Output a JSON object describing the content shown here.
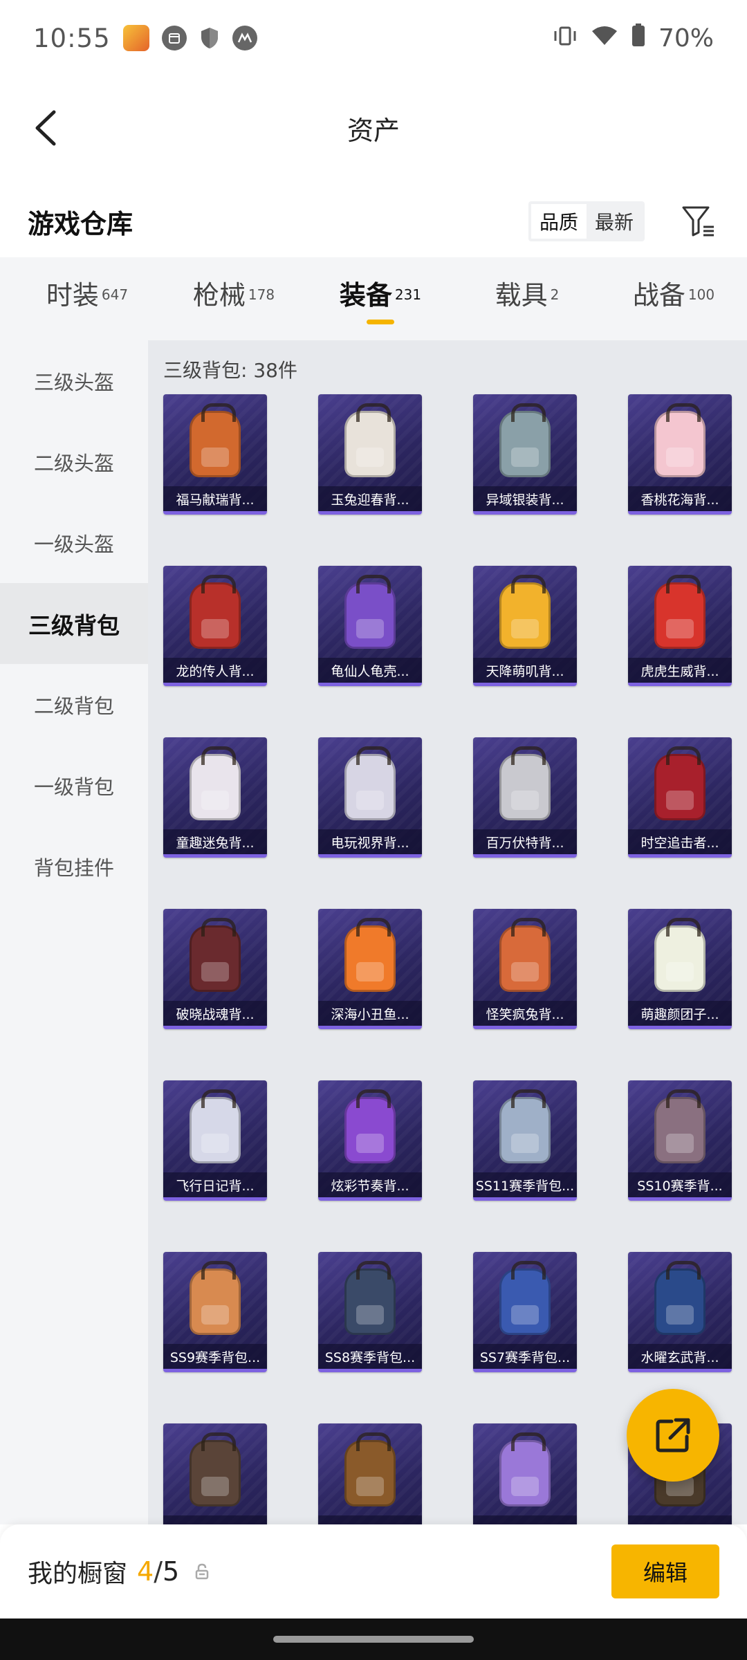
{
  "status_bar": {
    "time": "10:55",
    "battery": "70%",
    "icons": [
      "game-app-icon",
      "calendar-icon",
      "shield-icon",
      "motorola-icon",
      "vibrate-icon",
      "wifi-icon",
      "battery-icon"
    ]
  },
  "header": {
    "title": "资产"
  },
  "warehouse": {
    "title": "游戏仓库",
    "sort_options": [
      "品质",
      "最新"
    ],
    "active_sort": "品质"
  },
  "tabs": [
    {
      "label": "时装",
      "count": "647"
    },
    {
      "label": "枪械",
      "count": "178"
    },
    {
      "label": "装备",
      "count": "231",
      "active": true
    },
    {
      "label": "载具",
      "count": "2"
    },
    {
      "label": "战备",
      "count": "100"
    }
  ],
  "sidebar": {
    "items": [
      {
        "label": "三级头盔"
      },
      {
        "label": "二级头盔"
      },
      {
        "label": "一级头盔"
      },
      {
        "label": "三级背包",
        "active": true
      },
      {
        "label": "二级背包"
      },
      {
        "label": "一级背包"
      },
      {
        "label": "背包挂件"
      }
    ]
  },
  "main": {
    "section_title": "三级背包: 38件",
    "items": [
      {
        "name": "福马献瑞背...",
        "color": "#d2692e"
      },
      {
        "name": "玉兔迎春背...",
        "color": "#e8e2da"
      },
      {
        "name": "异域银装背...",
        "color": "#8aa0a8"
      },
      {
        "name": "香桃花海背...",
        "color": "#f4c6d0"
      },
      {
        "name": "龙的传人背...",
        "color": "#b8302a"
      },
      {
        "name": "龟仙人龟壳...",
        "color": "#7a4fc8"
      },
      {
        "name": "天降萌叽背...",
        "color": "#f2b22c"
      },
      {
        "name": "虎虎生威背...",
        "color": "#d8342c"
      },
      {
        "name": "童趣迷兔背...",
        "color": "#e9e4ec"
      },
      {
        "name": "电玩视界背...",
        "color": "#d7d5e4"
      },
      {
        "name": "百万伏特背...",
        "color": "#c9c9cf"
      },
      {
        "name": "时空追击者...",
        "color": "#a8202c"
      },
      {
        "name": "破晓战魂背...",
        "color": "#6a2a2e"
      },
      {
        "name": "深海小丑鱼...",
        "color": "#f07a2a"
      },
      {
        "name": "怪笑疯兔背...",
        "color": "#d86a3a"
      },
      {
        "name": "萌趣颜团子...",
        "color": "#eef0e0"
      },
      {
        "name": "飞行日记背...",
        "color": "#d6d8e8"
      },
      {
        "name": "炫彩节奏背...",
        "color": "#8a4ad0"
      },
      {
        "name": "SS11赛季背包...",
        "color": "#9fb0c8"
      },
      {
        "name": "SS10赛季背...",
        "color": "#8a7080"
      },
      {
        "name": "SS9赛季背包...",
        "color": "#d88a50"
      },
      {
        "name": "SS8赛季背包...",
        "color": "#3a4a68"
      },
      {
        "name": "SS7赛季背包...",
        "color": "#3a5ab0"
      },
      {
        "name": "水曜玄武背...",
        "color": "#2a4a8a"
      },
      {
        "name": "",
        "color": "#5a4438"
      },
      {
        "name": "",
        "color": "#8a5a2a"
      },
      {
        "name": "",
        "color": "#9a78d8"
      },
      {
        "name": "",
        "color": "#4a3a2a"
      }
    ]
  },
  "fab": {
    "icon": "share-icon"
  },
  "bottom_bar": {
    "showcase_label": "我的橱窗",
    "current": "4",
    "separator": "/",
    "total": "5",
    "edit_label": "编辑"
  }
}
